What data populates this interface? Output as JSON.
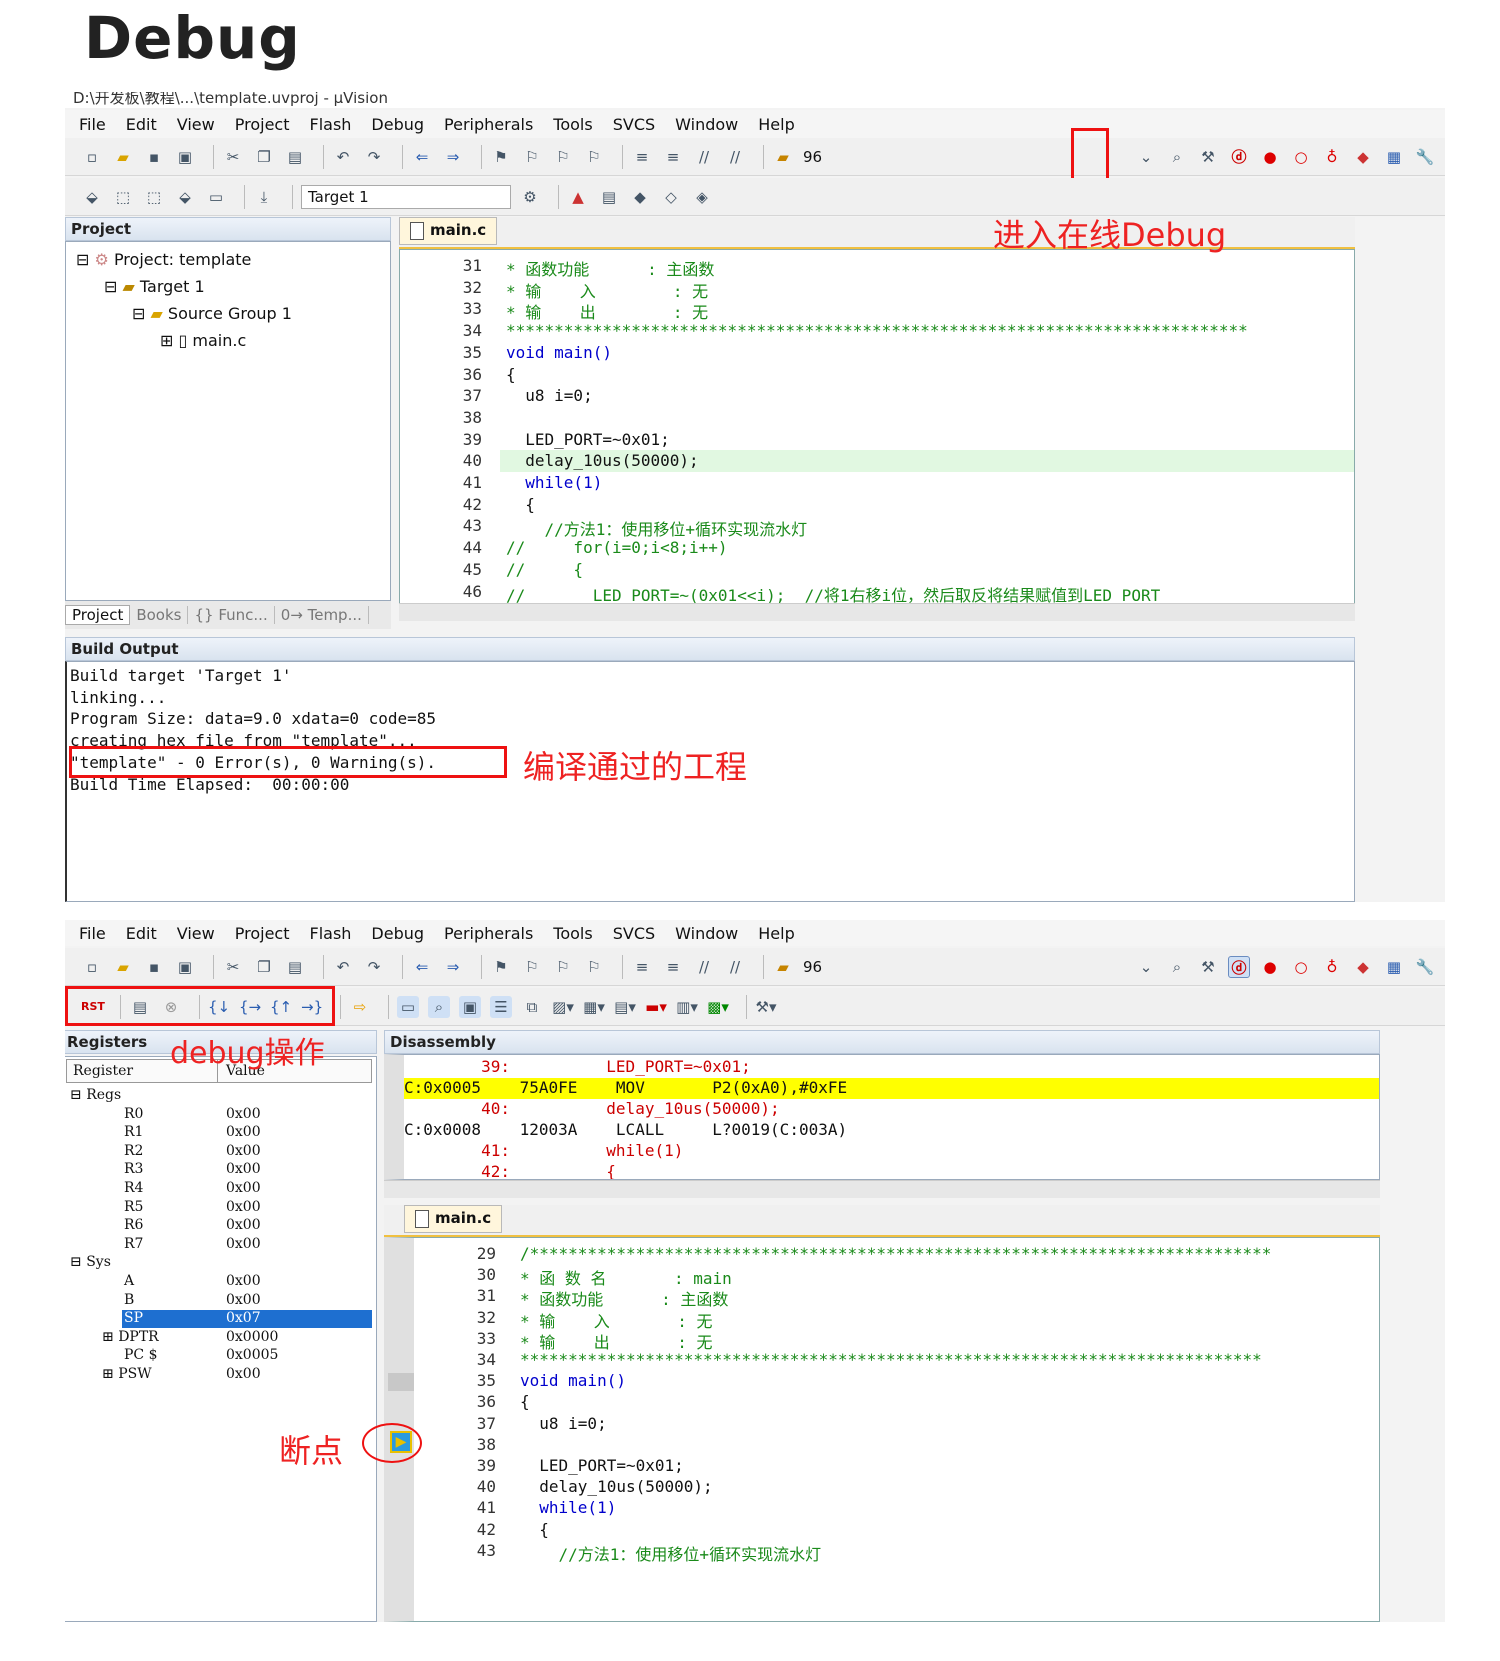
{
  "page_heading": "Debug",
  "shot1": {
    "titlebar": "D:\\开发板\\教程\\...\\template.uvproj - µVision",
    "menu": [
      "File",
      "Edit",
      "View",
      "Project",
      "Flash",
      "Debug",
      "Peripherals",
      "Tools",
      "SVCS",
      "Window",
      "Help"
    ],
    "toolbar_count": "96",
    "target_combo": "Target 1",
    "project_panel": {
      "title": "Project",
      "tree": [
        "Project: template",
        "Target 1",
        "Source Group 1",
        "main.c"
      ],
      "bottom_tabs": [
        "Project",
        "Books",
        "{} Func...",
        "0→ Temp..."
      ]
    },
    "editor": {
      "tab": "main.c",
      "lines": [
        {
          "n": "31",
          "t": "* 函数功能      : 主函数",
          "c": "cm"
        },
        {
          "n": "32",
          "t": "* 输    入        : 无",
          "c": "cm"
        },
        {
          "n": "33",
          "t": "* 输    出        : 无",
          "c": "cm"
        },
        {
          "n": "34",
          "t": "*****************************************************************************",
          "c": "cm"
        },
        {
          "n": "35",
          "t": "void main()",
          "c": "kw"
        },
        {
          "n": "36",
          "t": "{",
          "c": ""
        },
        {
          "n": "37",
          "t": "  u8 i=0;",
          "c": ""
        },
        {
          "n": "38",
          "t": "",
          "c": ""
        },
        {
          "n": "39",
          "t": "  LED_PORT=~0x01;",
          "c": ""
        },
        {
          "n": "40",
          "t": "  delay_10us(50000);",
          "c": ""
        },
        {
          "n": "41",
          "t": "  while(1)",
          "c": "kw"
        },
        {
          "n": "42",
          "t": "  {",
          "c": ""
        },
        {
          "n": "43",
          "t": "    //方法1：使用移位+循环实现流水灯",
          "c": "cm"
        },
        {
          "n": "44",
          "t": "//     for(i=0;i<8;i++)",
          "c": "cm"
        },
        {
          "n": "45",
          "t": "//     {",
          "c": "cm"
        },
        {
          "n": "46",
          "t": "//       LED_PORT=~(0x01<<i);  //将1右移i位，然后取反将结果赋值到LED_PORT",
          "c": "cm"
        }
      ]
    },
    "annotation_debug": "进入在线Debug",
    "build_output": {
      "title": "Build Output",
      "lines": [
        "Build target 'Target 1'",
        "linking...",
        "Program Size: data=9.0 xdata=0 code=85",
        "creating hex file from \"template\"...",
        "\"template\" - 0 Error(s), 0 Warning(s).",
        "Build Time Elapsed:  00:00:00"
      ],
      "annotation": "编译通过的工程"
    }
  },
  "shot2": {
    "menu": [
      "File",
      "Edit",
      "View",
      "Project",
      "Flash",
      "Debug",
      "Peripherals",
      "Tools",
      "SVCS",
      "Window",
      "Help"
    ],
    "toolbar_count": "96",
    "annotation_debug_ops": "debug操作",
    "registers": {
      "title": "Registers",
      "col_register": "Register",
      "col_value": "Value",
      "rows": [
        {
          "name": "Regs",
          "value": "",
          "lvl": 0
        },
        {
          "name": "R0",
          "value": "0x00",
          "lvl": 1
        },
        {
          "name": "R1",
          "value": "0x00",
          "lvl": 1
        },
        {
          "name": "R2",
          "value": "0x00",
          "lvl": 1
        },
        {
          "name": "R3",
          "value": "0x00",
          "lvl": 1
        },
        {
          "name": "R4",
          "value": "0x00",
          "lvl": 1
        },
        {
          "name": "R5",
          "value": "0x00",
          "lvl": 1
        },
        {
          "name": "R6",
          "value": "0x00",
          "lvl": 1
        },
        {
          "name": "R7",
          "value": "0x00",
          "lvl": 1
        },
        {
          "name": "Sys",
          "value": "",
          "lvl": 0
        },
        {
          "name": "A",
          "value": "0x00",
          "lvl": 1
        },
        {
          "name": "B",
          "value": "0x00",
          "lvl": 1
        },
        {
          "name": "SP",
          "value": "0x07",
          "lvl": 1,
          "sel": true
        },
        {
          "name": "DPTR",
          "value": "0x0000",
          "lvl": 1
        },
        {
          "name": "PC $",
          "value": "0x0005",
          "lvl": 1
        },
        {
          "name": "PSW",
          "value": "0x00",
          "lvl": 1
        }
      ]
    },
    "disassembly": {
      "title": "Disassembly",
      "lines": [
        {
          "t": "        39:          LED_PORT=~0x01;",
          "cls": "src"
        },
        {
          "t": "C:0x0005    75A0FE    MOV       P2(0xA0),#0xFE",
          "cls": "cur"
        },
        {
          "t": "        40:          delay_10us(50000);",
          "cls": "src"
        },
        {
          "t": "C:0x0008    12003A    LCALL     L?0019(C:003A)",
          "cls": ""
        },
        {
          "t": "        41:          while(1)",
          "cls": "src"
        },
        {
          "t": "        42:          {",
          "cls": "src"
        }
      ]
    },
    "editor": {
      "tab": "main.c",
      "lines": [
        {
          "n": "29",
          "t": "/*****************************************************************************",
          "c": "cm"
        },
        {
          "n": "30",
          "t": "* 函 数 名       : main",
          "c": "cm"
        },
        {
          "n": "31",
          "t": "* 函数功能      : 主函数",
          "c": "cm"
        },
        {
          "n": "32",
          "t": "* 输    入       : 无",
          "c": "cm"
        },
        {
          "n": "33",
          "t": "* 输    出       : 无",
          "c": "cm"
        },
        {
          "n": "34",
          "t": "*****************************************************************************",
          "c": "cm"
        },
        {
          "n": "35",
          "t": "void main()",
          "c": "kw"
        },
        {
          "n": "36",
          "t": "{",
          "c": ""
        },
        {
          "n": "37",
          "t": "  u8 i=0;",
          "c": ""
        },
        {
          "n": "38",
          "t": "",
          "c": ""
        },
        {
          "n": "39",
          "t": "  LED_PORT=~0x01;",
          "c": ""
        },
        {
          "n": "40",
          "t": "  delay_10us(50000);",
          "c": ""
        },
        {
          "n": "41",
          "t": "  while(1)",
          "c": "kw"
        },
        {
          "n": "42",
          "t": "  {",
          "c": ""
        },
        {
          "n": "43",
          "t": "    //方法1：使用移位+循环实现流水灯",
          "c": "cm"
        }
      ]
    },
    "annotation_breakpoint": "断点"
  }
}
